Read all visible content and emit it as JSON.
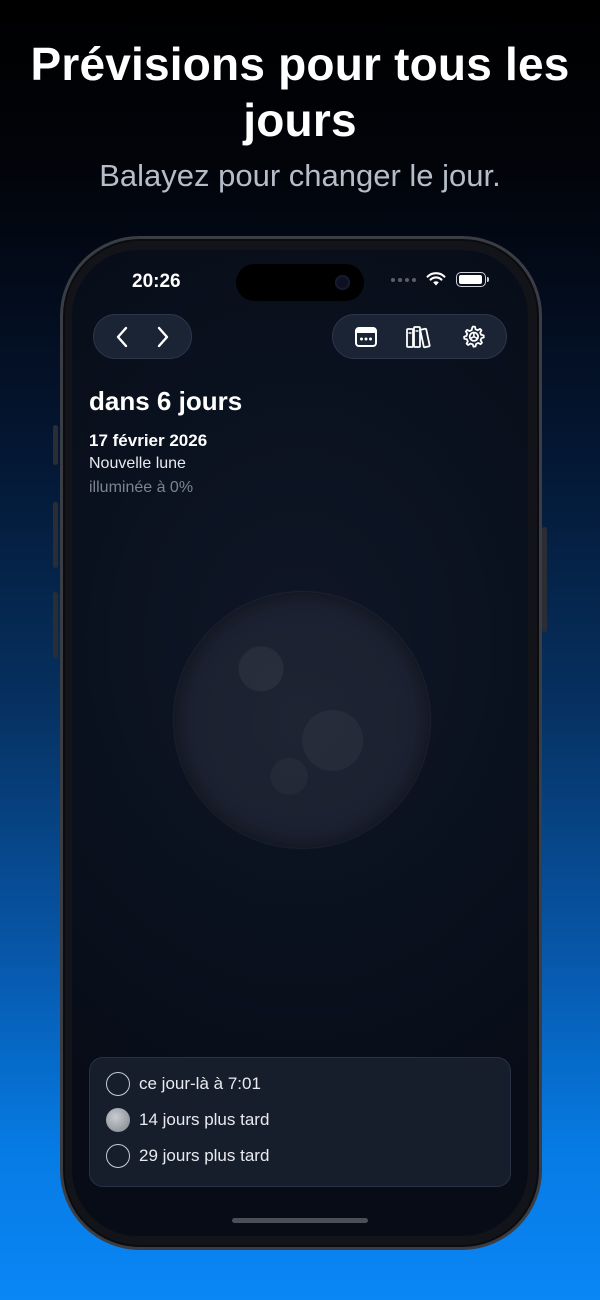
{
  "hero": {
    "title": "Prévisions pour tous les jours",
    "subtitle": "Balayez pour changer le jour."
  },
  "status_bar": {
    "time": "20:26",
    "battery_level": 1.0
  },
  "toolbar": {
    "prev_icon": "chevron-left-icon",
    "next_icon": "chevron-right-icon",
    "calendar_icon": "calendar-icon",
    "library_icon": "books-icon",
    "settings_icon": "gear-icon"
  },
  "day": {
    "relative": "dans 6 jours",
    "date": "17 février 2026",
    "phase": "Nouvelle lune",
    "illumination": "illuminée à 0%"
  },
  "events": [
    {
      "icon": "new-moon-icon",
      "label": "ce jour-là à 7:01"
    },
    {
      "icon": "full-moon-icon",
      "label": "14 jours plus tard"
    },
    {
      "icon": "new-moon-icon",
      "label": "29 jours plus tard"
    }
  ],
  "colors": {
    "background_top": "#000000",
    "background_bottom": "#0a86f5",
    "accent": "#0a86f5"
  }
}
